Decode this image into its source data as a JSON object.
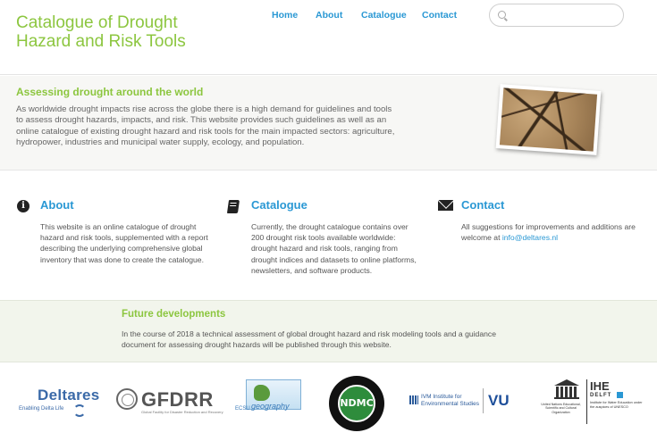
{
  "header": {
    "site_title": "Catalogue of Drought Hazard and Risk Tools",
    "nav": [
      {
        "label": "Home"
      },
      {
        "label": "About"
      },
      {
        "label": "Catalogue"
      },
      {
        "label": "Contact"
      }
    ],
    "search": {
      "placeholder": "",
      "value": "",
      "icon": "search-icon"
    }
  },
  "intro": {
    "heading": "Assessing drought around the world",
    "body": "As worldwide drought impacts rise across the globe there is a high demand for guidelines and tools to assess drought hazards, impacts, and risk. This website provides such guidelines as well as an online catalogue of existing drought hazard and risk tools for the main impacted sectors: agriculture, hydropower, industries and municipal water supply, ecology, and population."
  },
  "columns": {
    "about": {
      "icon": "info-icon",
      "title": "About",
      "body": "This website is an online catalogue of drought hazard and risk tools, supplemented with a report describing the underlying comprehensive global inventory that was done to create the catalogue."
    },
    "catalogue": {
      "icon": "book-icon",
      "title": "Catalogue",
      "body": "Currently, the drought catalogue contains over 200 drought risk tools available worldwide: drought hazard and risk tools, ranging from drought indices and datasets to online platforms, newsletters, and software products."
    },
    "contact": {
      "icon": "envelope-icon",
      "title": "Contact",
      "body": "All suggestions for improvements and additions are welcome at ",
      "email": "info@deltares.nl"
    }
  },
  "future": {
    "heading": "Future developments",
    "body": "In the course of 2018 a technical assessment of global drought hazard and risk modeling tools and a guidance document for assessing drought hazards will be published through this website."
  },
  "logos": {
    "deltares": {
      "name": "Deltares",
      "tagline": "Enabling Delta Life"
    },
    "gfdrr": {
      "name": "GFDRR",
      "tagline": "Global Facility for Disaster Reduction and Recovery"
    },
    "ecsu": {
      "prefix": "ECSU",
      "name": "geography"
    },
    "ndmc": {
      "name": "NDMC"
    },
    "ivm": {
      "line1": "IVM Institute for",
      "line2": "Environmental Studies",
      "vu": "VU"
    },
    "unesco": {
      "org": "United Nations Educational, Scientific and Cultural Organization",
      "ihe": "IHE",
      "delft": "DELFT",
      "institute": "Institute for Water Education under the auspices of UNESCO"
    }
  },
  "colors": {
    "accent_green": "#8cc63f",
    "link_blue": "#2a98d4",
    "band_green": "#f2f5ec"
  }
}
